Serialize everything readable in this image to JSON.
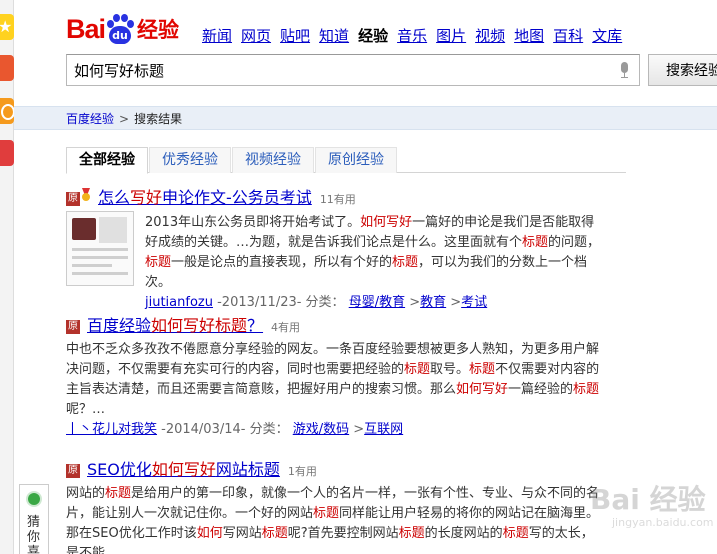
{
  "header": {
    "logo_bai": "Bai",
    "logo_du": "du",
    "logo_jingyan": "经验",
    "nav": [
      "新闻",
      "网页",
      "贴吧",
      "知道",
      "经验",
      "音乐",
      "图片",
      "视频",
      "地图",
      "百科",
      "文库"
    ],
    "nav_current": "经验",
    "search_value": "如何写好标题",
    "search_button": "搜索经验"
  },
  "breadcrumb": {
    "home": "百度经验",
    "separator": ">",
    "current": "搜索结果"
  },
  "tabs": [
    "全部经验",
    "优秀经验",
    "视频经验",
    "原创经验"
  ],
  "active_tab": "全部经验",
  "results": [
    {
      "badge": "原",
      "title_pre": "怎么",
      "title_hl": "写好",
      "title_post": "申论作文-公务员考试",
      "count": "11有用",
      "body": [
        {
          "t": "2013年山东公务员即将开始考试了。"
        },
        {
          "t": "如何写好",
          "hl": true
        },
        {
          "t": "一篇好的申论是我们是否能取得好成绩的关键。…为题，就是告诉我们论点是什么。这里面就有个"
        },
        {
          "t": "标题",
          "hl": true
        },
        {
          "t": "的问题，"
        },
        {
          "t": "标题",
          "hl": true
        },
        {
          "t": "一般是论点的直接表现，所以有个好的"
        },
        {
          "t": "标题",
          "hl": true
        },
        {
          "t": "，可以为我们的分数上一个档次。"
        }
      ],
      "author": "jiutianfozu",
      "date_meta": " -2013/11/23- 分类：",
      "categories": [
        "母婴/教育",
        "教育",
        "考试"
      ]
    },
    {
      "badge": "原",
      "title_pre": "百度经验",
      "title_hl": "如何写好标题",
      "title_post": "？",
      "count": "4有用",
      "body": [
        {
          "t": "中也不乏众多孜孜不倦愿意分享经验的网友。一条百度经验要想被更多人熟知，为更多用户解决问题，不仅需要有充实可行的内容，同时也需要把经验的"
        },
        {
          "t": "标题",
          "hl": true
        },
        {
          "t": "取号。"
        },
        {
          "t": "标题",
          "hl": true
        },
        {
          "t": "不仅需要对内容的主旨表达清楚，而且还需要言简意赅，把握好用户的搜索习惯。那么"
        },
        {
          "t": "如何写好",
          "hl": true
        },
        {
          "t": "一篇经验的"
        },
        {
          "t": "标题",
          "hl": true
        },
        {
          "t": "呢？…"
        }
      ],
      "author": "丨丶花儿对我笑",
      "date_meta": " -2014/03/14- 分类：",
      "categories": [
        "游戏/数码",
        "互联网"
      ]
    },
    {
      "badge": "原",
      "title_pre": "SEO优化",
      "title_hl": "如何写好",
      "title_post": "网站标题",
      "count": "1有用",
      "body": [
        {
          "t": "网站的"
        },
        {
          "t": "标题",
          "hl": true
        },
        {
          "t": "是给用户的第一印象，就像一个人的名片一样，一张有个性、专业、与众不同的名片，能让别人一次就记住你。一个好的网站"
        },
        {
          "t": "标题",
          "hl": true
        },
        {
          "t": "同样能让用户轻易的将你的网站记在脑海里。那在SEO优化工作时该"
        },
        {
          "t": "如何",
          "hl": true
        },
        {
          "t": "写网站"
        },
        {
          "t": "标题",
          "hl": true
        },
        {
          "t": "呢?首先要控制网站"
        },
        {
          "t": "标题",
          "hl": true
        },
        {
          "t": "的长度网站的"
        },
        {
          "t": "标题",
          "hl": true
        },
        {
          "t": "写的太长，是不能"
        }
      ]
    }
  ],
  "side_widget": {
    "label": "猜你喜"
  },
  "watermark": {
    "logo": "Bai 经验",
    "url": "jingyan.baidu.com"
  },
  "colors": {
    "brand_red": "#e10601",
    "brand_blue": "#2932e1",
    "link": "#0000cc",
    "highlight": "#cc0000"
  }
}
